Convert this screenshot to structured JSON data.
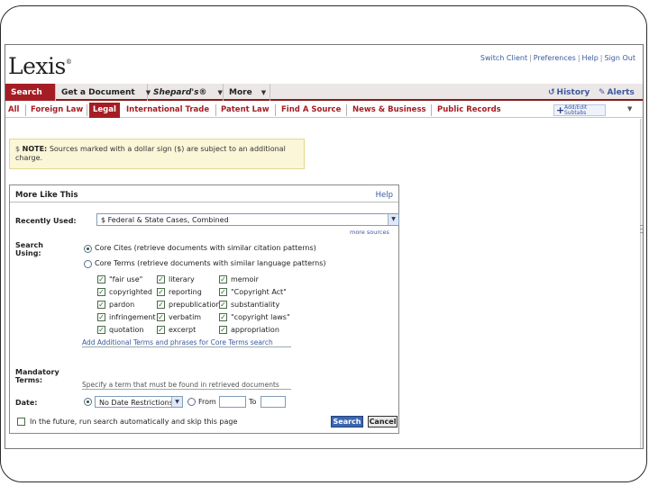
{
  "logo": "Lexis",
  "logo_mark": "®",
  "top_links": [
    "Switch Client",
    "Preferences",
    "Help",
    "Sign Out"
  ],
  "main_tabs": [
    {
      "label": "Search",
      "has_menu": true
    },
    {
      "label": "Get a Document",
      "has_menu": true
    },
    {
      "label": "Shepard's®",
      "has_menu": true
    },
    {
      "label": "More",
      "has_menu": true
    }
  ],
  "history_label": "History",
  "alerts_label": "Alerts",
  "sub_tabs": [
    "All",
    "Foreign Law",
    "Legal",
    "International Trade",
    "Patent Law",
    "Find A Source",
    "News & Business",
    "Public Records"
  ],
  "add_subtab_label": "Add/Edit Subtabs",
  "note": {
    "bold": "NOTE:",
    "text": "Sources marked with a dollar sign ($) are subject to an additional charge."
  },
  "panel": {
    "title": "More Like This",
    "help": "Help",
    "recently_used_label": "Recently Used:",
    "recently_used_value": "$   Federal & State Cases, Combined",
    "more_sources": "more sources",
    "search_using_label": "Search Using:",
    "option_core_cites": "Core Cites (retrieve documents with similar citation patterns)",
    "option_core_terms": "Core Terms (retrieve documents with similar language patterns)",
    "terms": [
      {
        "label": "\"fair use\"",
        "checked": true
      },
      {
        "label": "literary",
        "checked": true
      },
      {
        "label": "memoir",
        "checked": true
      },
      {
        "label": "copyrighted",
        "checked": true
      },
      {
        "label": "reporting",
        "checked": true
      },
      {
        "label": "\"Copyright Act\"",
        "checked": true
      },
      {
        "label": "pardon",
        "checked": true
      },
      {
        "label": "prepublication",
        "checked": true
      },
      {
        "label": "substantiality",
        "checked": true
      },
      {
        "label": "infringement",
        "checked": true
      },
      {
        "label": "verbatim",
        "checked": true
      },
      {
        "label": "\"copyright laws\"",
        "checked": true
      },
      {
        "label": "quotation",
        "checked": true
      },
      {
        "label": "excerpt",
        "checked": true
      },
      {
        "label": "appropriation",
        "checked": true
      }
    ],
    "add_terms_link": "Add Additional Terms and phrases for Core Terms search",
    "mandatory_label": "Mandatory Terms:",
    "mandatory_placeholder": "Specify a term that must be found in retrieved documents",
    "date_label": "Date:",
    "date_value": "No Date Restrictions",
    "from_label": "From",
    "to_label": "To",
    "future_label": "In the future, run search automatically and skip this page",
    "search_button": "Search",
    "cancel_button": "Cancel"
  },
  "colors": {
    "brand_red": "#a51d24",
    "link_blue": "#3b5aa0",
    "note_bg": "#fbf6d8"
  }
}
